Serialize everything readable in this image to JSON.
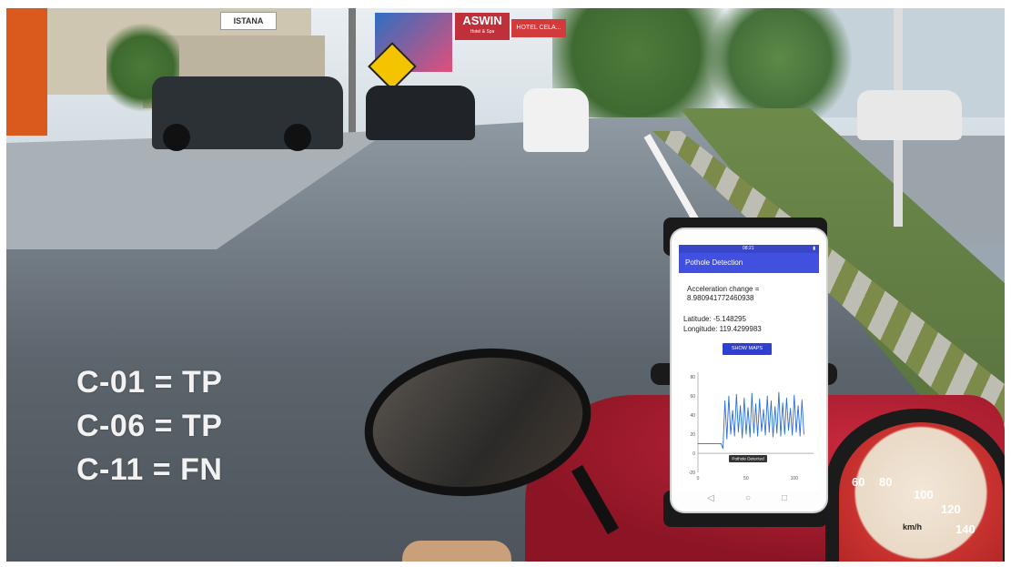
{
  "scene": {
    "signs": {
      "istana": "ISTANA",
      "aswin": "ASWIN",
      "aswin_sub": "Hotel & Spa",
      "hotel": "HOTEL CELA..."
    },
    "speedometer": {
      "ticks": [
        "60",
        "80",
        "100",
        "120",
        "140"
      ],
      "unit": "km/h"
    }
  },
  "phone": {
    "status_time": "08:21",
    "app_title": "Pothole Detection",
    "acceleration_label": "Acceleration change =",
    "acceleration_value": "8.980941772460938",
    "latitude": "Latitude: -5.148295",
    "longitude": "Longitude: 119.4299983",
    "show_maps_button": "SHOW MAPS",
    "chart_annotation": "Pothole Detected",
    "nav": [
      "◁",
      "○",
      "□"
    ]
  },
  "chart_data": {
    "type": "line",
    "title": "",
    "xlabel": "",
    "ylabel": "",
    "x_ticks": [
      "0",
      "50",
      "100"
    ],
    "y_ticks": [
      "80",
      "60",
      "40",
      "20",
      "0",
      "-20"
    ],
    "xlim": [
      0,
      120
    ],
    "ylim": [
      -20,
      85
    ],
    "series": [
      {
        "color": "#2a6fd6",
        "x": [
          0,
          5,
          10,
          15,
          20,
          24,
          26,
          28,
          30,
          32,
          34,
          36,
          38,
          40,
          42,
          44,
          46,
          48,
          50,
          52,
          54,
          56,
          58,
          60,
          62,
          64,
          66,
          68,
          70,
          72,
          74,
          76,
          78,
          80,
          82,
          84,
          86,
          88,
          90,
          92,
          94,
          96,
          98,
          100,
          102,
          104,
          106,
          108,
          110
        ],
        "y": [
          10,
          10,
          10,
          10,
          10,
          10,
          5,
          55,
          15,
          60,
          20,
          45,
          18,
          62,
          22,
          50,
          16,
          58,
          20,
          48,
          17,
          63,
          21,
          52,
          18,
          57,
          23,
          46,
          19,
          60,
          22,
          55,
          17,
          49,
          21,
          64,
          18,
          53,
          20,
          58,
          24,
          47,
          19,
          61,
          22,
          50,
          18,
          56,
          20
        ]
      }
    ],
    "grid": false,
    "legend": "none"
  },
  "overlay": {
    "labels": [
      "C-01 = TP",
      "C-06 = TP",
      "C-11 = FN"
    ]
  }
}
